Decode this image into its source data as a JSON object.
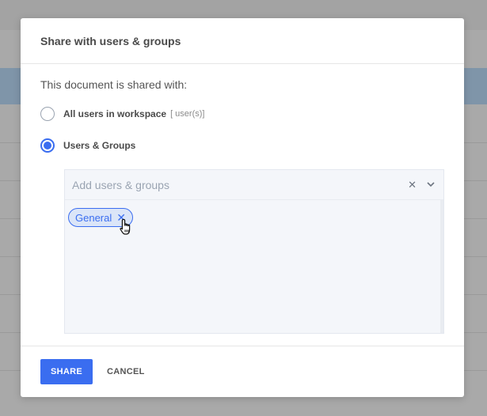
{
  "dialog": {
    "title": "Share with users & groups",
    "intro": "This document is shared with:",
    "options": [
      {
        "label": "All users in workspace",
        "sublabel": "[ user(s)]",
        "selected": false
      },
      {
        "label": "Users & Groups",
        "selected": true
      }
    ],
    "select": {
      "placeholder": "Add users & groups",
      "clear_icon": "close-icon",
      "toggle_icon": "chevron-down-icon",
      "tags": [
        {
          "label": "General",
          "remove_icon": "close-icon"
        }
      ]
    },
    "buttons": {
      "share": "SHARE",
      "cancel": "CANCEL"
    }
  },
  "colors": {
    "accent": "#3a6df0",
    "tag_background": "#dbe5f8"
  }
}
